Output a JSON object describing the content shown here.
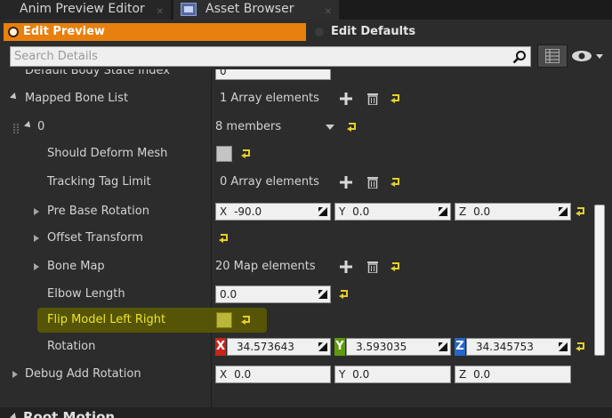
{
  "tabs": [
    {
      "label": "Anim Preview Editor"
    },
    {
      "label": "Asset Browser"
    }
  ],
  "mode": {
    "edit_preview": "Edit Preview",
    "edit_defaults": "Edit Defaults"
  },
  "search": {
    "placeholder": "Search Details"
  },
  "rows": {
    "default_body_state_index": {
      "label": "Default Body State Index",
      "value": "0"
    },
    "mapped_bone_list": {
      "label": "Mapped Bone List",
      "value": "1 Array elements"
    },
    "element_0": {
      "label": "0",
      "value": "8 members"
    },
    "should_deform_mesh": {
      "label": "Should Deform Mesh"
    },
    "tracking_tag_limit": {
      "label": "Tracking Tag Limit",
      "value": "0 Array elements"
    },
    "pre_base_rotation": {
      "label": "Pre Base Rotation",
      "x_label": "X",
      "x": "-90.0",
      "y_label": "Y",
      "y": "0.0",
      "z_label": "Z",
      "z": "0.0"
    },
    "offset_transform": {
      "label": "Offset Transform"
    },
    "bone_map": {
      "label": "Bone Map",
      "value": "20 Map elements"
    },
    "elbow_length": {
      "label": "Elbow Length",
      "value": "0.0"
    },
    "flip_model_left_right": {
      "label": "Flip Model Left Right"
    },
    "rotation": {
      "label": "Rotation",
      "x_label": "X",
      "x": "34.573643",
      "y_label": "Y",
      "y": "3.593035",
      "z_label": "Z",
      "z": "34.345753"
    },
    "debug_add_rotation": {
      "label": "Debug Add Rotation",
      "x_label": "X",
      "x": "0.0",
      "y_label": "Y",
      "y": "0.0",
      "z_label": "Z",
      "z": "0.0"
    },
    "root_motion": {
      "label": "Root Motion"
    }
  },
  "colors": {
    "accent": "#e8800e",
    "highlight": "#e5e31a",
    "x_axis": "#c8251d",
    "y_axis": "#5f9a0e",
    "z_axis": "#2667c9"
  }
}
